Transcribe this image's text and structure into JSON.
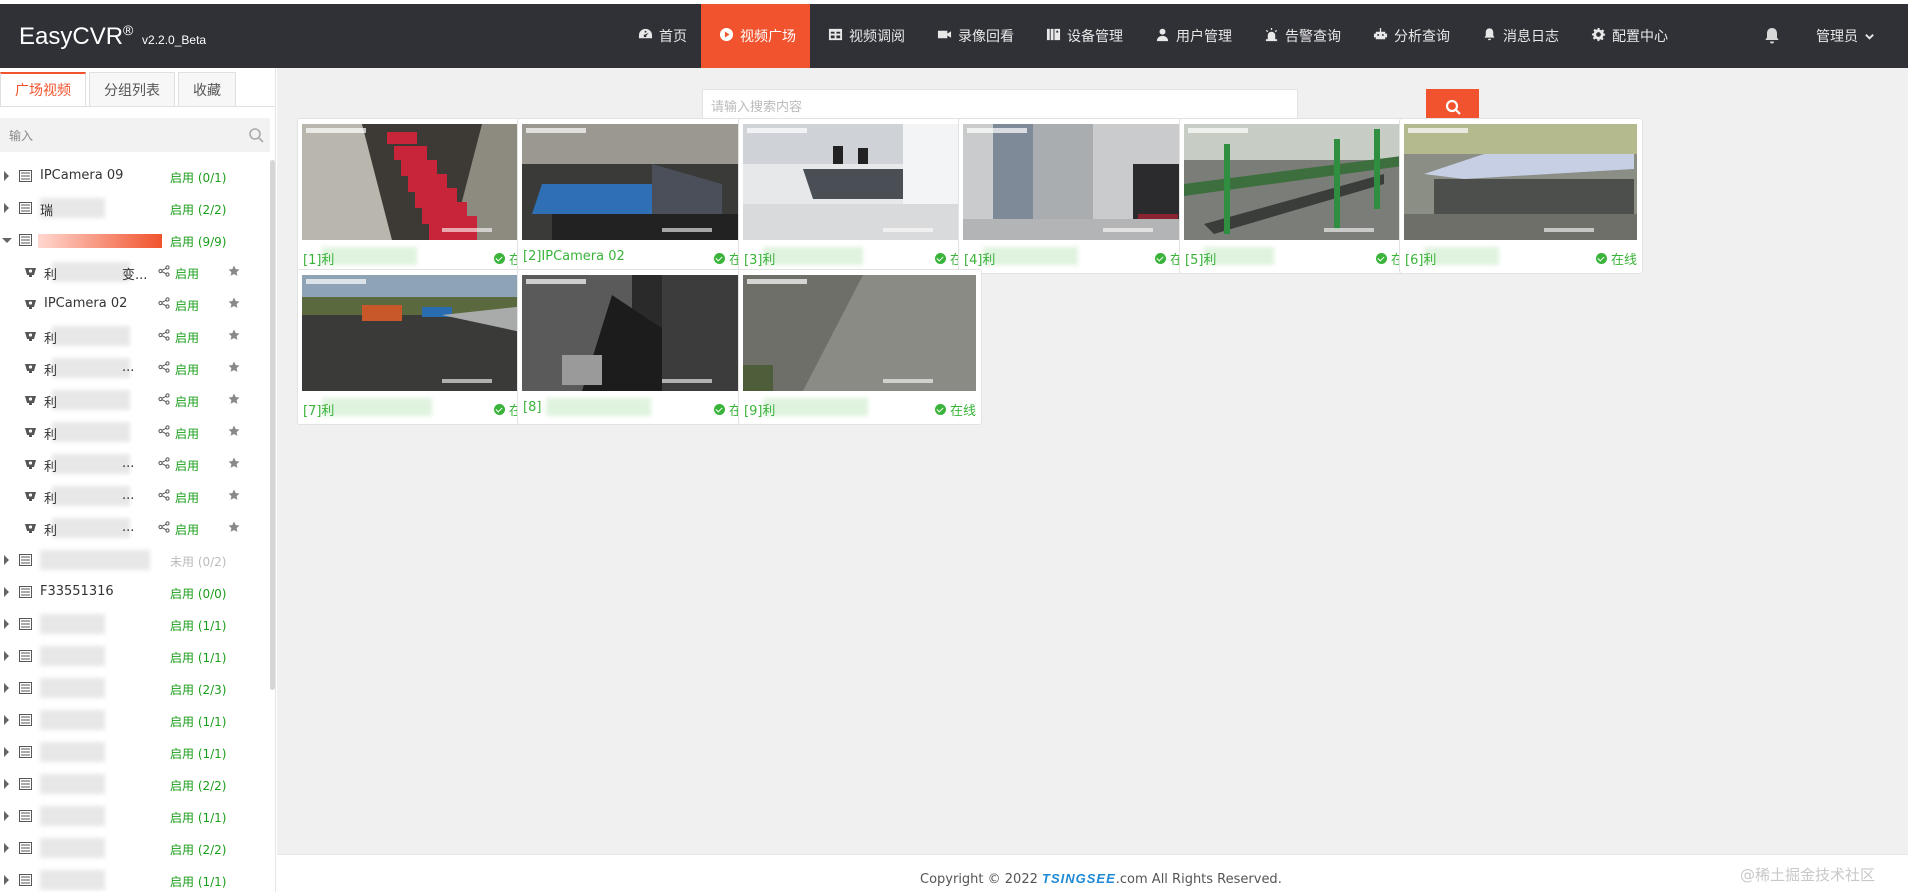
{
  "brand": {
    "name": "EasyCVR",
    "reg": "®",
    "version": "v2.2.0_Beta"
  },
  "nav": [
    {
      "label": "首页",
      "icon": "dashboard-icon",
      "active": false
    },
    {
      "label": "视频广场",
      "icon": "play-circle-icon",
      "active": true
    },
    {
      "label": "视频调阅",
      "icon": "table-icon",
      "active": false
    },
    {
      "label": "录像回看",
      "icon": "video-camera-icon",
      "active": false
    },
    {
      "label": "设备管理",
      "icon": "device-icon",
      "active": false
    },
    {
      "label": "用户管理",
      "icon": "user-icon",
      "active": false
    },
    {
      "label": "告警查询",
      "icon": "alarm-icon",
      "active": false
    },
    {
      "label": "分析查询",
      "icon": "robot-icon",
      "active": false
    },
    {
      "label": "消息日志",
      "icon": "bell-icon",
      "active": false
    },
    {
      "label": "配置中心",
      "icon": "gear-icon",
      "active": false
    }
  ],
  "user": {
    "label": "管理员"
  },
  "sidebar": {
    "tabs": [
      {
        "label": "广场视频",
        "active": true
      },
      {
        "label": "分组列表",
        "active": false
      },
      {
        "label": "收藏",
        "active": false
      }
    ],
    "search_placeholder": "输入",
    "tree": [
      {
        "type": "device",
        "name": "IPCamera 09",
        "status": "启用 (0/1)",
        "open": false
      },
      {
        "type": "device",
        "name": "瑞",
        "status": "启用 (2/2)",
        "open": false,
        "blur": true
      },
      {
        "type": "device",
        "name": "",
        "status": "启用 (9/9)",
        "open": true,
        "highlight": true
      },
      {
        "type": "camera",
        "name": "利",
        "suffix": "变...",
        "status": "启用",
        "blur": true
      },
      {
        "type": "camera",
        "name": "IPCamera 02",
        "suffix": "",
        "status": "启用",
        "blur": false
      },
      {
        "type": "camera",
        "name": "利",
        "suffix": "",
        "status": "启用",
        "blur": true
      },
      {
        "type": "camera",
        "name": "利",
        "suffix": "...",
        "status": "启用",
        "blur": true
      },
      {
        "type": "camera",
        "name": "利",
        "suffix": "",
        "status": "启用",
        "blur": true
      },
      {
        "type": "camera",
        "name": "利",
        "suffix": "",
        "status": "启用",
        "blur": true
      },
      {
        "type": "camera",
        "name": "利",
        "suffix": "...",
        "status": "启用",
        "blur": true
      },
      {
        "type": "camera",
        "name": "利",
        "suffix": "...",
        "status": "启用",
        "blur": true
      },
      {
        "type": "camera",
        "name": "利",
        "suffix": "...",
        "status": "启用",
        "blur": true
      },
      {
        "type": "device",
        "name": "",
        "status": "未用 (0/2)",
        "open": false,
        "off": true,
        "blur": true
      },
      {
        "type": "device",
        "name": "F33551316",
        "status": "启用 (0/0)",
        "open": false
      },
      {
        "type": "device",
        "name": "",
        "status": "启用 (1/1)",
        "open": false,
        "blur": true
      },
      {
        "type": "device",
        "name": "",
        "status": "启用 (1/1)",
        "open": false,
        "blur": true
      },
      {
        "type": "device",
        "name": "",
        "status": "启用 (2/3)",
        "open": false,
        "blur": true
      },
      {
        "type": "device",
        "name": "",
        "status": "启用 (1/1)",
        "open": false,
        "blur": true
      },
      {
        "type": "device",
        "name": "",
        "status": "启用 (1/1)",
        "open": false,
        "blur": true
      },
      {
        "type": "device",
        "name": "",
        "status": "启用 (2/2)",
        "open": false,
        "blur": true
      },
      {
        "type": "device",
        "name": "",
        "status": "启用 (1/1)",
        "open": false,
        "blur": true
      },
      {
        "type": "device",
        "name": "",
        "status": "启用 (2/2)",
        "open": false,
        "blur": true
      },
      {
        "type": "device",
        "name": "",
        "status": "启用 (1/1)",
        "open": false,
        "blur": true
      }
    ]
  },
  "search": {
    "placeholder": "请输入搜索内容"
  },
  "cards": [
    {
      "label": "[1]利",
      "status": "在线",
      "scene": "red-machines"
    },
    {
      "label": "[2]IPCamera 02",
      "status": "在线",
      "scene": "blue-machine"
    },
    {
      "label": "[3]利",
      "status": "在线",
      "scene": "control-room"
    },
    {
      "label": "[4]利",
      "status": "在线",
      "scene": "indoor-motor"
    },
    {
      "label": "[5]利",
      "status": "在线",
      "scene": "conveyor"
    },
    {
      "label": "[6]利",
      "status": "在线",
      "scene": "shed"
    },
    {
      "label": "[7]利",
      "status": "在线",
      "scene": "yard"
    },
    {
      "label": "[8]",
      "status": "在线",
      "scene": "chute"
    },
    {
      "label": "[9]利",
      "status": "在线",
      "scene": "wall"
    }
  ],
  "footer": {
    "prefix": "Copyright © 2022 ",
    "brand": "TSINGSEE",
    "suffix": ".com All Rights Reserved."
  },
  "watermark": "@稀土掘金技术社区",
  "colors": {
    "accent": "#f0532d",
    "nav_bg": "#2f3137",
    "online": "#3ab33a",
    "enabled": "#1a9e1a"
  }
}
